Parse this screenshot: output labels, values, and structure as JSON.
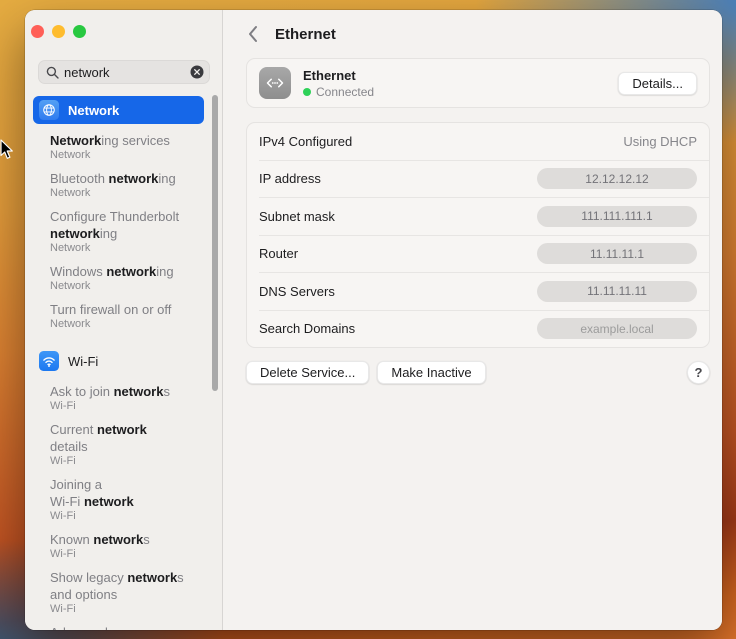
{
  "colors": {
    "accent_blue": "#1667e8",
    "connected_green": "#2ed158",
    "traffic_red": "#ff5f57",
    "traffic_yellow": "#febc2e",
    "traffic_green": "#28c840"
  },
  "window": {
    "controls": [
      "close",
      "minimize",
      "zoom"
    ]
  },
  "sidebar": {
    "search": {
      "value": "network"
    },
    "groups": [
      {
        "label": "Network",
        "icon": "globe-icon",
        "selected": true,
        "items": [
          {
            "title": [
              [
                "Network",
                1
              ],
              [
                "ing services",
                0
              ]
            ],
            "subtitle": "Network"
          },
          {
            "title": [
              [
                "Bluetooth ",
                0
              ],
              [
                "network",
                1
              ],
              [
                "ing",
                0
              ]
            ],
            "subtitle": "Network"
          },
          {
            "title": [
              [
                "Configure Thunderbolt\n",
                0
              ],
              [
                "network",
                1
              ],
              [
                "ing",
                0
              ]
            ],
            "subtitle": "Network"
          },
          {
            "title": [
              [
                "Windows ",
                0
              ],
              [
                "network",
                1
              ],
              [
                "ing",
                0
              ]
            ],
            "subtitle": "Network"
          },
          {
            "title": [
              [
                "Turn firewall on or off",
                0
              ]
            ],
            "subtitle": "Network"
          }
        ]
      },
      {
        "label": "Wi-Fi",
        "icon": "wifi-icon",
        "selected": false,
        "items": [
          {
            "title": [
              [
                "Ask to join ",
                0
              ],
              [
                "network",
                1
              ],
              [
                "s",
                0
              ]
            ],
            "subtitle": "Wi-Fi"
          },
          {
            "title": [
              [
                "Current ",
                0
              ],
              [
                "network",
                1
              ],
              [
                "\ndetails",
                0
              ]
            ],
            "subtitle": "Wi-Fi"
          },
          {
            "title": [
              [
                "Joining a\nWi-Fi ",
                0
              ],
              [
                "network",
                1
              ]
            ],
            "subtitle": "Wi-Fi"
          },
          {
            "title": [
              [
                "Known ",
                0
              ],
              [
                "network",
                1
              ],
              [
                "s",
                0
              ]
            ],
            "subtitle": "Wi-Fi"
          },
          {
            "title": [
              [
                "Show legacy ",
                0
              ],
              [
                "network",
                1
              ],
              [
                "s\nand options",
                0
              ]
            ],
            "subtitle": "Wi-Fi"
          },
          {
            "title": [
              [
                "Advanced",
                0
              ]
            ],
            "subtitle": ""
          }
        ]
      }
    ]
  },
  "main": {
    "title": "Ethernet",
    "service": {
      "name": "Ethernet",
      "status": "Connected",
      "details_button": "Details..."
    },
    "settings_rows": [
      {
        "label": "IPv4 Configured",
        "value": "Using DHCP",
        "style": "text"
      },
      {
        "label": "IP address",
        "value": "12.12.12.12",
        "style": "pill"
      },
      {
        "label": "Subnet mask",
        "value": "111.111.111.1",
        "style": "pill"
      },
      {
        "label": "Router",
        "value": "11.11.11.1",
        "style": "pill"
      },
      {
        "label": "DNS Servers",
        "value": "11.11.11.11",
        "style": "pill"
      },
      {
        "label": "Search Domains",
        "value": "example.local",
        "style": "pill-placeholder"
      }
    ],
    "footer": {
      "delete_button": "Delete Service...",
      "inactive_button": "Make Inactive",
      "help_button": "?"
    }
  }
}
